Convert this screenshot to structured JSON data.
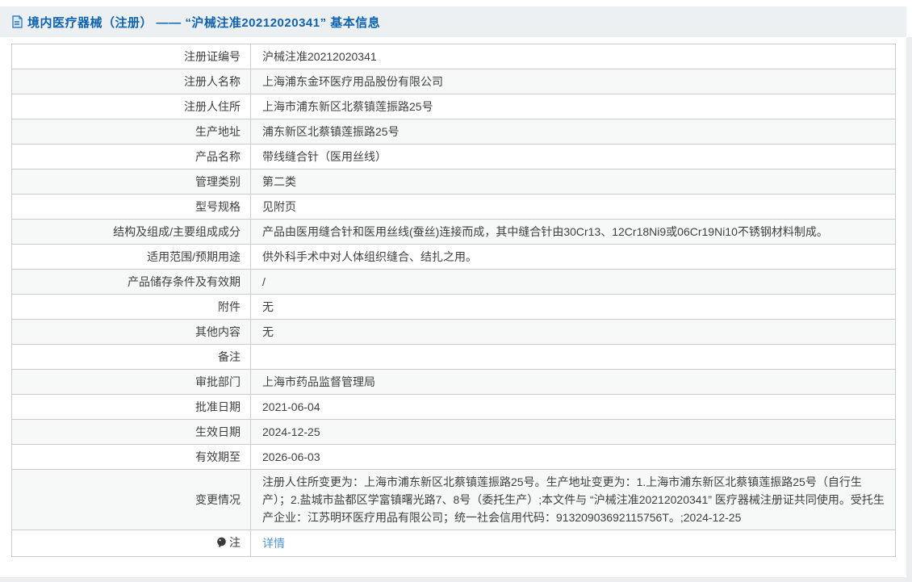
{
  "page": {
    "title": "境内医疗器械（注册） —— “沪械注准20212020341” 基本信息"
  },
  "colors": {
    "title_blue": "#0e63b0",
    "link_blue": "#4e96db",
    "titlebar_bg": "#edf0f3",
    "row_alt_bg": "#f7f8f8",
    "border": "#cccccc"
  },
  "table": {
    "rows": [
      {
        "label": "注册证编号",
        "value": "沪械注准20212020341"
      },
      {
        "label": "注册人名称",
        "value": "上海浦东金环医疗用品股份有限公司"
      },
      {
        "label": "注册人住所",
        "value": "上海市浦东新区北蔡镇莲振路25号"
      },
      {
        "label": "生产地址",
        "value": "浦东新区北蔡镇莲振路25号"
      },
      {
        "label": "产品名称",
        "value": "带线缝合针（医用丝线）"
      },
      {
        "label": "管理类别",
        "value": "第二类"
      },
      {
        "label": "型号规格",
        "value": "见附页"
      },
      {
        "label": "结构及组成/主要组成成分",
        "value": "产品由医用缝合针和医用丝线(蚕丝)连接而成，其中缝合针由30Cr13、12Cr18Ni9或06Cr19Ni10不锈钢材料制成。"
      },
      {
        "label": "适用范围/预期用途",
        "value": "供外科手术中对人体组织缝合、结扎之用。"
      },
      {
        "label": "产品储存条件及有效期",
        "value": "/"
      },
      {
        "label": "附件",
        "value": "无"
      },
      {
        "label": "其他内容",
        "value": "无"
      },
      {
        "label": "备注",
        "value": ""
      },
      {
        "label": "审批部门",
        "value": "上海市药品监督管理局"
      },
      {
        "label": "批准日期",
        "value": "2021-06-04"
      },
      {
        "label": "生效日期",
        "value": "2024-12-25"
      },
      {
        "label": "有效期至",
        "value": "2026-06-03"
      },
      {
        "label": "变更情况",
        "value": "注册人住所变更为：上海市浦东新区北蔡镇莲振路25号。生产地址变更为：1.上海市浦东新区北蔡镇莲振路25号（自行生产）；2.盐城市盐都区学富镇曙光路7、8号（委托生产）;本文件与 “沪械注准20212020341” 医疗器械注册证共同使用。受托生产企业：江苏明环医疗用品有限公司；统一社会信用代码：91320903692115756T。;2024-12-25"
      },
      {
        "label": "注",
        "value": "详情",
        "link": true,
        "label_icon": "comment-icon"
      }
    ]
  }
}
